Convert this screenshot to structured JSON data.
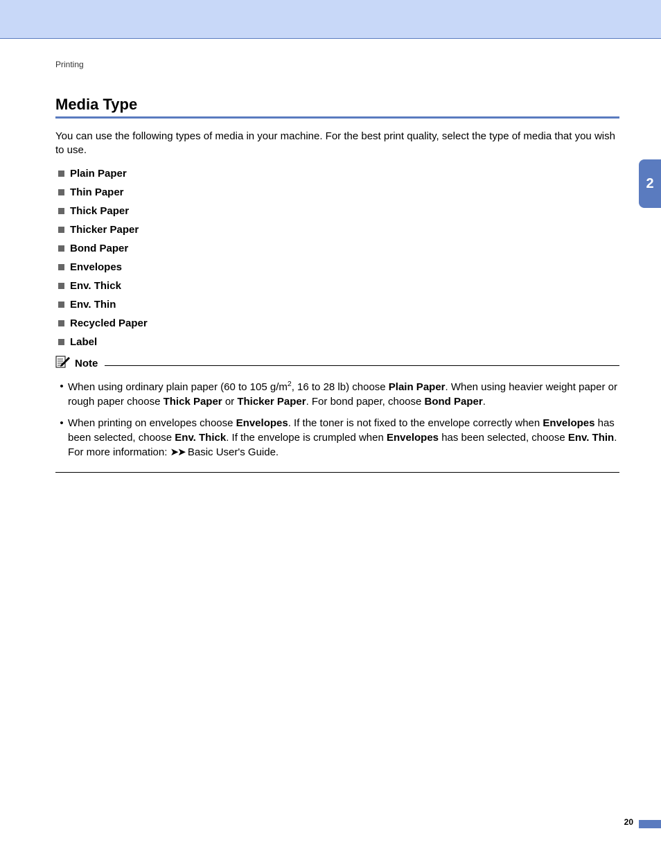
{
  "breadcrumb": "Printing",
  "section_title": "Media Type",
  "intro_text": "You can use the following types of media in your machine. For the best print quality, select the type of media that you wish to use.",
  "media_types": [
    "Plain Paper",
    "Thin Paper",
    "Thick Paper",
    "Thicker Paper",
    "Bond Paper",
    "Envelopes",
    "Env. Thick",
    "Env. Thin",
    "Recycled Paper",
    "Label"
  ],
  "note_label": "Note",
  "note1": {
    "pre": "When using ordinary plain paper (60 to 105 g/m",
    "sup": "2",
    "mid1": ", 16 to 28 lb) choose ",
    "b1": "Plain Paper",
    "mid2": ". When using heavier weight paper or rough paper choose ",
    "b2": "Thick Paper",
    "mid3": " or ",
    "b3": "Thicker Paper",
    "mid4": ". For bond paper, choose ",
    "b4": "Bond Paper",
    "end": "."
  },
  "note2": {
    "pre": "When printing on envelopes choose ",
    "b1": "Envelopes",
    "mid1": ". If the toner is not fixed to the envelope correctly when ",
    "b2": "Envelopes",
    "mid2": " has been selected, choose ",
    "b3": "Env. Thick",
    "mid3": ". If the envelope is crumpled when ",
    "b4": "Envelopes",
    "mid4": " has been selected, choose ",
    "b5": "Env. Thin",
    "mid5": ". For more information: ",
    "arrows": "➤➤",
    "end": " Basic User's Guide."
  },
  "tab_number": "2",
  "page_number": "20"
}
